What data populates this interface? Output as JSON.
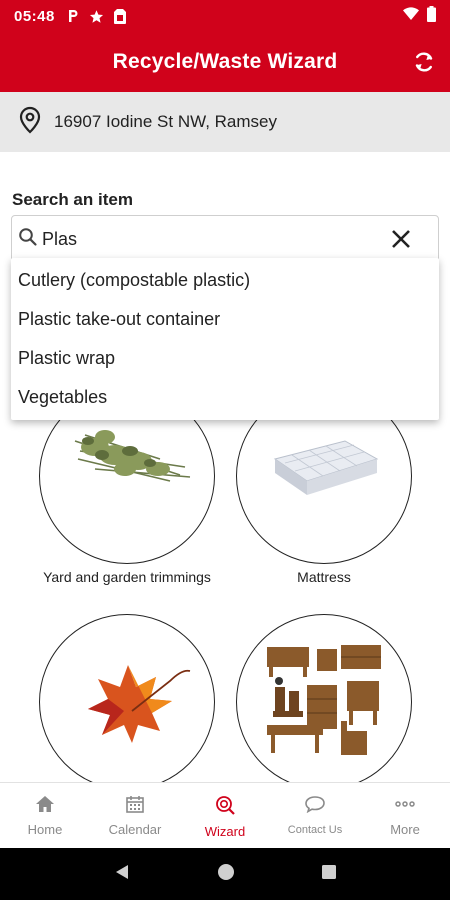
{
  "status_bar": {
    "time": "05:48",
    "icons": [
      "parking-icon",
      "star-icon",
      "sim-card-icon",
      "wifi-icon",
      "battery-icon"
    ]
  },
  "app_bar": {
    "title": "Recycle/Waste Wizard",
    "action_icon": "refresh-icon"
  },
  "location": {
    "icon": "location-pin-icon",
    "address": "16907 Iodine St NW, Ramsey"
  },
  "search": {
    "label": "Search an item",
    "value": "Plas",
    "suggestions": [
      "Cutlery (compostable plastic)",
      "Plastic take-out container",
      "Plastic wrap",
      "Vegetables"
    ]
  },
  "tiles": [
    {
      "label": "Yard and garden trimmings",
      "icon": "yard-trimmings-image"
    },
    {
      "label": "Mattress",
      "icon": "mattress-image"
    },
    {
      "label": "",
      "icon": "autumn-leaf-image"
    },
    {
      "label": "",
      "icon": "furniture-image"
    }
  ],
  "bottom_nav": {
    "items": [
      {
        "label": "Home",
        "icon": "home-icon",
        "active": false
      },
      {
        "label": "Calendar",
        "icon": "calendar-icon",
        "active": false
      },
      {
        "label": "Wizard",
        "icon": "wizard-icon",
        "active": true
      },
      {
        "label": "Contact Us",
        "icon": "chat-icon",
        "active": false
      },
      {
        "label": "More",
        "icon": "more-icon",
        "active": false
      }
    ]
  },
  "colors": {
    "brand_red": "#d0021b",
    "location_bar_bg": "#e8e8e8",
    "inactive_nav": "#8a8a8a"
  }
}
